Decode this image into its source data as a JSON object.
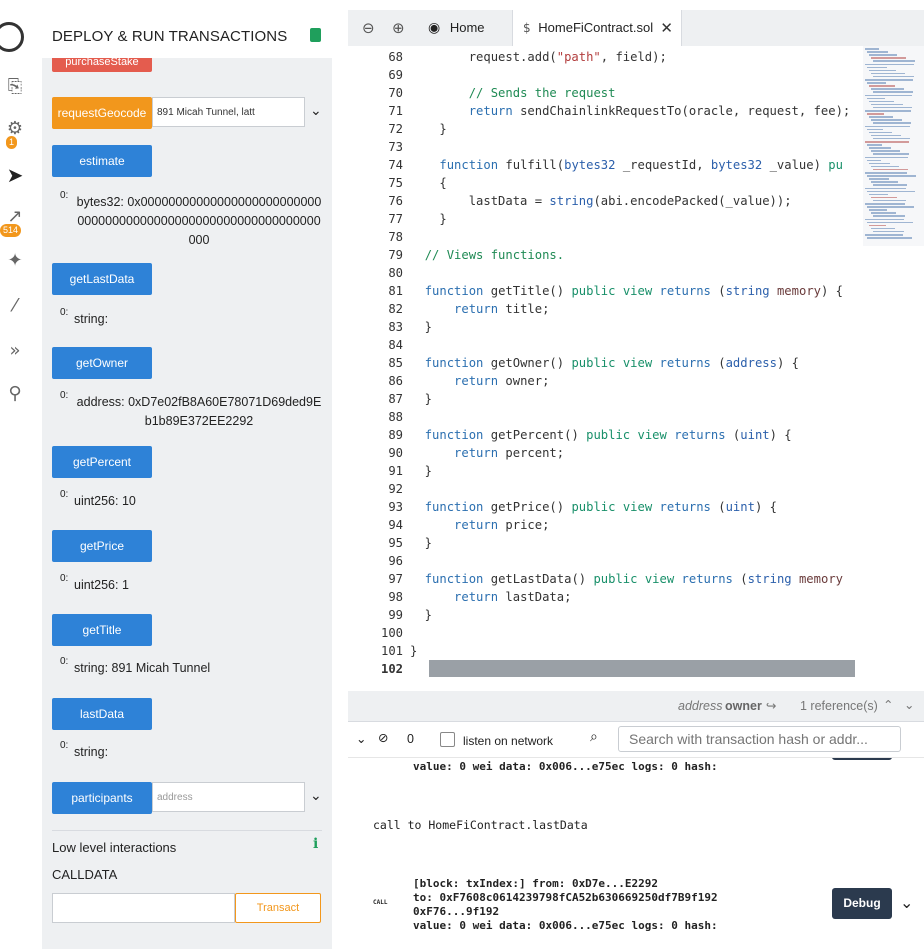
{
  "iconbar": {
    "badge_compile": "1",
    "badge_deploy": "514"
  },
  "panel": {
    "title": "DEPLOY & RUN TRANSACTIONS",
    "purchase_label": "purchaseStake",
    "request_geocode": {
      "label": "requestGeocode",
      "value": "891 Micah Tunnel, latt"
    },
    "functions": [
      {
        "label": "estimate",
        "key": "0:",
        "value": "bytes32: 0x0000000000000000000000000000000000000000000000000000000000000000"
      },
      {
        "label": "getLastData",
        "key": "0:",
        "value": "string:"
      },
      {
        "label": "getOwner",
        "key": "0:",
        "value": "address: 0xD7e02fB8A60E78071D69ded9Eb1b89E372EE2292"
      },
      {
        "label": "getPercent",
        "key": "0:",
        "value": "uint256: 10"
      },
      {
        "label": "getPrice",
        "key": "0:",
        "value": "uint256: 1"
      },
      {
        "label": "getTitle",
        "key": "0:",
        "value": "string: 891 Micah Tunnel"
      },
      {
        "label": "lastData",
        "key": "0:",
        "value": "string:"
      }
    ],
    "participants": {
      "label": "participants",
      "placeholder": "address"
    },
    "low_level": "Low level interactions",
    "calldata": "CALLDATA",
    "transact": "Transact"
  },
  "tabs": {
    "home": "Home",
    "file": "HomeFiContract.sol"
  },
  "editor": {
    "lines": [
      {
        "n": "68",
        "html": "        request.add(<span class=\"str\">\"path\"</span>, field);"
      },
      {
        "n": "69",
        "html": ""
      },
      {
        "n": "70",
        "html": "        <span class=\"cm\">// Sends the request</span>"
      },
      {
        "n": "71",
        "html": "        <span class=\"kw\">return</span> sendChainlinkRequestTo(oracle, request, fee);"
      },
      {
        "n": "72",
        "html": "    }"
      },
      {
        "n": "73",
        "html": ""
      },
      {
        "n": "74",
        "html": "    <span class=\"kw\">function</span> fulfill(<span class=\"ty\">bytes32</span> _requestId, <span class=\"ty\">bytes32</span> _value) <span class=\"pub\">pu</span>"
      },
      {
        "n": "75",
        "html": "    {"
      },
      {
        "n": "76",
        "html": "        lastData = <span class=\"ty\">string</span>(abi.encodePacked(_value));"
      },
      {
        "n": "77",
        "html": "    }"
      },
      {
        "n": "78",
        "html": ""
      },
      {
        "n": "79",
        "html": "  <span class=\"cm\">// Views functions.</span>"
      },
      {
        "n": "80",
        "html": ""
      },
      {
        "n": "81",
        "html": "  <span class=\"kw\">function</span> getTitle() <span class=\"pub\">public</span> <span class=\"pub\">view</span> <span class=\"kw\">returns</span> (<span class=\"ty\">string</span> <span class=\"fnm\">memory</span>) {"
      },
      {
        "n": "82",
        "html": "      <span class=\"kw\">return</span> title;"
      },
      {
        "n": "83",
        "html": "  }"
      },
      {
        "n": "84",
        "html": ""
      },
      {
        "n": "85",
        "html": "  <span class=\"kw\">function</span> getOwner() <span class=\"pub\">public</span> <span class=\"pub\">view</span> <span class=\"kw\">returns</span> (<span class=\"ty\">address</span>) {"
      },
      {
        "n": "86",
        "html": "      <span class=\"kw\">return</span> owner;"
      },
      {
        "n": "87",
        "html": "  }"
      },
      {
        "n": "88",
        "html": ""
      },
      {
        "n": "89",
        "html": "  <span class=\"kw\">function</span> getPercent() <span class=\"pub\">public</span> <span class=\"pub\">view</span> <span class=\"kw\">returns</span> (<span class=\"ty\">uint</span>) {"
      },
      {
        "n": "90",
        "html": "      <span class=\"kw\">return</span> percent;"
      },
      {
        "n": "91",
        "html": "  }"
      },
      {
        "n": "92",
        "html": ""
      },
      {
        "n": "93",
        "html": "  <span class=\"kw\">function</span> getPrice() <span class=\"pub\">public</span> <span class=\"pub\">view</span> <span class=\"kw\">returns</span> (<span class=\"ty\">uint</span>) {"
      },
      {
        "n": "94",
        "html": "      <span class=\"kw\">return</span> price;"
      },
      {
        "n": "95",
        "html": "  }"
      },
      {
        "n": "96",
        "html": ""
      },
      {
        "n": "97",
        "html": "  <span class=\"kw\">function</span> getLastData() <span class=\"pub\">public</span> <span class=\"pub\">view</span> <span class=\"kw\">returns</span> (<span class=\"ty\">string</span> <span class=\"fnm\">memory</span>"
      },
      {
        "n": "98",
        "html": "      <span class=\"kw\">return</span> lastData;"
      },
      {
        "n": "99",
        "html": "  }"
      },
      {
        "n": "100",
        "html": ""
      },
      {
        "n": "101",
        "html": "}"
      },
      {
        "n": "102",
        "html": ""
      }
    ]
  },
  "refbar": {
    "type": "address",
    "name": "owner",
    "refs": "1 reference(s)"
  },
  "terminal": {
    "count": "0",
    "listen": "listen on network",
    "search_placeholder": "Search with transaction hash or addr...",
    "top_value": "value: 0 wei data: 0x006...e75ec logs: 0 hash:",
    "call_text": "call to HomeFiContract.lastData",
    "call_tag": "CALL",
    "block": "[block: txIndex:]  from: 0xD7e...E2292",
    "to": "to: 0xF7608c0614239798fCA52b630669250df7B9f192",
    "to2": "0xF76...9f192",
    "value": "value: 0 wei data: 0x006...e75ec logs: 0 hash:",
    "debug": "Debug"
  }
}
